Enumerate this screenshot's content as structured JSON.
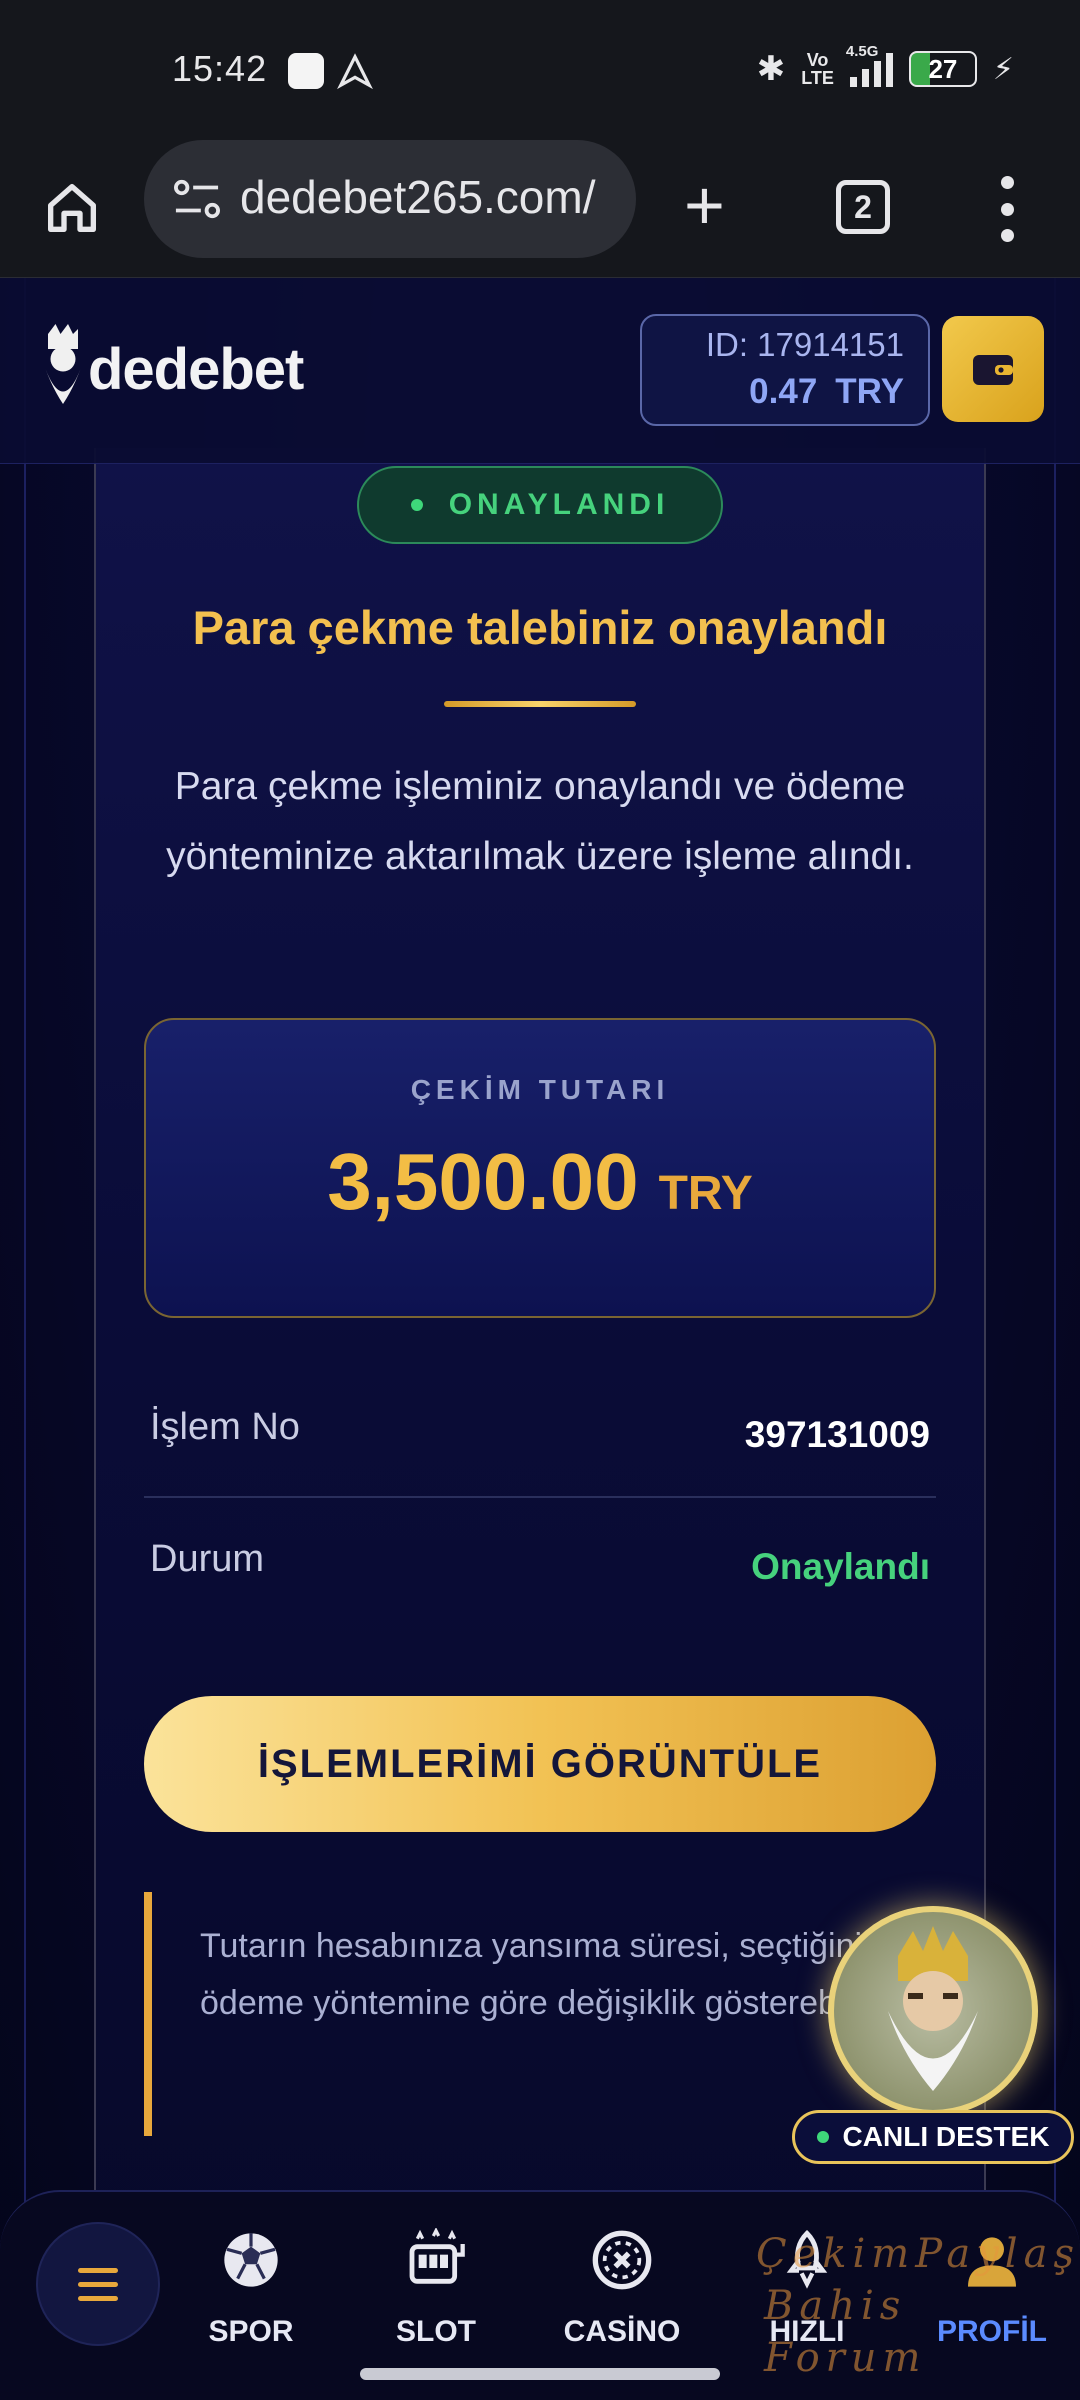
{
  "status_bar": {
    "time": "15:42",
    "network": "4.5G",
    "volte_top": "Vo",
    "volte_bottom": "LTE",
    "battery": "27"
  },
  "browser": {
    "url": "dedebet265.com/",
    "tab_count": "2"
  },
  "header": {
    "logo_text": "dedebet",
    "account_id": "ID: 17914151",
    "balance_value": "0.47",
    "balance_currency": "TRY"
  },
  "status_badge": "ONAYLANDI",
  "title": "Para çekme talebiniz onaylandı",
  "description": "Para çekme işleminiz onaylandı ve ödeme yönteminize aktarılmak üzere işleme alındı.",
  "amount": {
    "label": "ÇEKİM TUTARI",
    "value": "3,500.00",
    "currency": "TRY"
  },
  "details": [
    {
      "label": "İşlem No",
      "value": "397131009"
    },
    {
      "label": "Durum",
      "value": "Onaylandı"
    }
  ],
  "cta_label": "İŞLEMLERİMİ GÖRÜNTÜLE",
  "note": "Tutarın hesabınıza yansıma süresi, seçtiğiniz ödeme yöntemine göre değişiklik gösterebilir.",
  "live_support": "CANLI DESTEK",
  "bottom_nav": [
    {
      "label": "SPOR",
      "icon": "soccer-ball-icon"
    },
    {
      "label": "SLOT",
      "icon": "slot-machine-icon"
    },
    {
      "label": "CASİNO",
      "icon": "casino-chip-icon"
    },
    {
      "label": "HIZLI",
      "icon": "rocket-icon"
    },
    {
      "label": "PROFİL",
      "icon": "user-icon"
    }
  ],
  "watermark": {
    "line1": "ÇekimPaylaş",
    "line2": "Bahis Forum"
  },
  "colors": {
    "accent_gold": "#f3bd45",
    "success_green": "#46d27d",
    "page_bg": "#07082a",
    "active_nav": "#5b8bff"
  }
}
